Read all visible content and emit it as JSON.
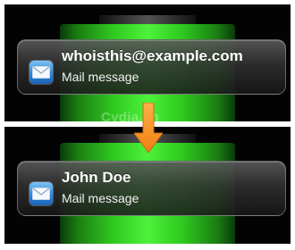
{
  "notifications": [
    {
      "sender": "whoisthis@example.com",
      "subtitle": "Mail message",
      "app_icon": "mail-icon"
    },
    {
      "sender": "John Doe",
      "subtitle": "Mail message",
      "app_icon": "mail-icon"
    }
  ],
  "watermark": "Cydia.vn",
  "transition_icon": "arrow-down-icon",
  "colors": {
    "background": "#030303",
    "battery_green": "#3de02a",
    "arrow_orange": "#f7941d",
    "mail_icon_blue": "#2f86d8",
    "text": "#ffffff"
  }
}
